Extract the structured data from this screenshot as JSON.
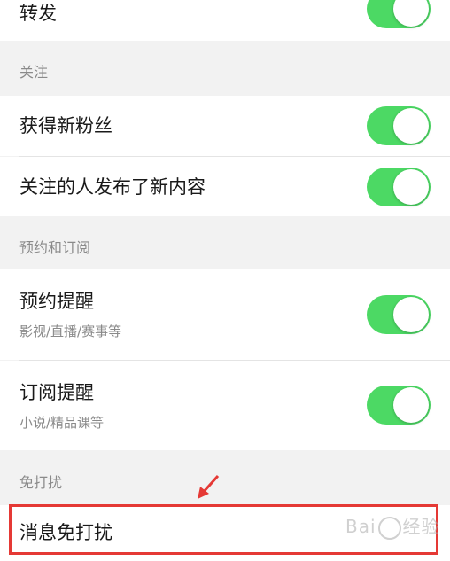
{
  "top_row": {
    "label": "转发",
    "toggle_on": true
  },
  "section_follow": {
    "title": "关注",
    "items": [
      {
        "label": "获得新粉丝",
        "toggle_on": true
      },
      {
        "label": "关注的人发布了新内容",
        "toggle_on": true
      }
    ]
  },
  "section_booking": {
    "title": "预约和订阅",
    "items": [
      {
        "label": "预约提醒",
        "sub": "影视/直播/赛事等",
        "toggle_on": true
      },
      {
        "label": "订阅提醒",
        "sub": "小说/精品课等",
        "toggle_on": true
      }
    ]
  },
  "section_dnd": {
    "title": "免打扰",
    "items": [
      {
        "label": "消息免打扰"
      }
    ]
  },
  "watermark": {
    "text_left": "Bai",
    "text_right": "经验"
  },
  "colors": {
    "toggle_on": "#4cd964",
    "highlight": "#e53935",
    "section_text": "#8a8a8a"
  },
  "icons": {
    "toggle": "switch-on",
    "arrow": "red-pointer-arrow"
  }
}
